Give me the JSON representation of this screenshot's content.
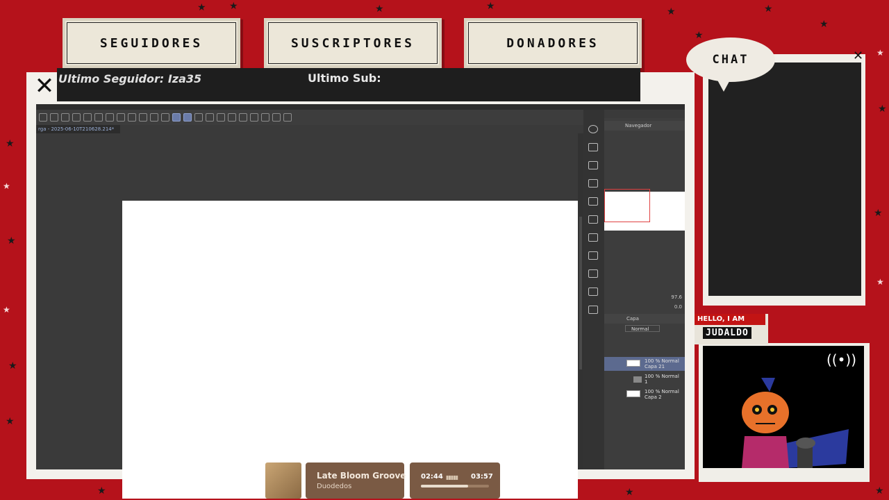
{
  "overlay": {
    "labels": [
      "SEGUIDORES",
      "SUSCRIPTORES",
      "DONADORES"
    ],
    "last_follower": "Ultimo Seguidor: Iza35",
    "last_sub": "Ultimo Sub:",
    "close_symbol": "✕"
  },
  "app": {
    "document_tab": "rga - 2025-06-10T210628.214*",
    "zoom_value": "97.6",
    "angle_value": "0.0",
    "navigator_title": "Navegador",
    "layer_panel_title": "Capa",
    "blend_mode": "Normal",
    "layers": [
      {
        "line1": "100 % Normal",
        "line2": "Capa 21",
        "selected": true
      },
      {
        "line1": "100 % Normal",
        "line2": "1",
        "selected": false
      },
      {
        "line1": "100 % Normal",
        "line2": "Capa 2",
        "selected": false
      }
    ]
  },
  "chat": {
    "title": "CHAT",
    "close_symbol": "✕"
  },
  "camera": {
    "hello": "HELLO, I AM",
    "name": "JUDALDO"
  },
  "player": {
    "title": "Late Bloom Groove",
    "artist": "Duodedos",
    "elapsed": "02:44",
    "total": "03:57",
    "progress": 0.69
  }
}
